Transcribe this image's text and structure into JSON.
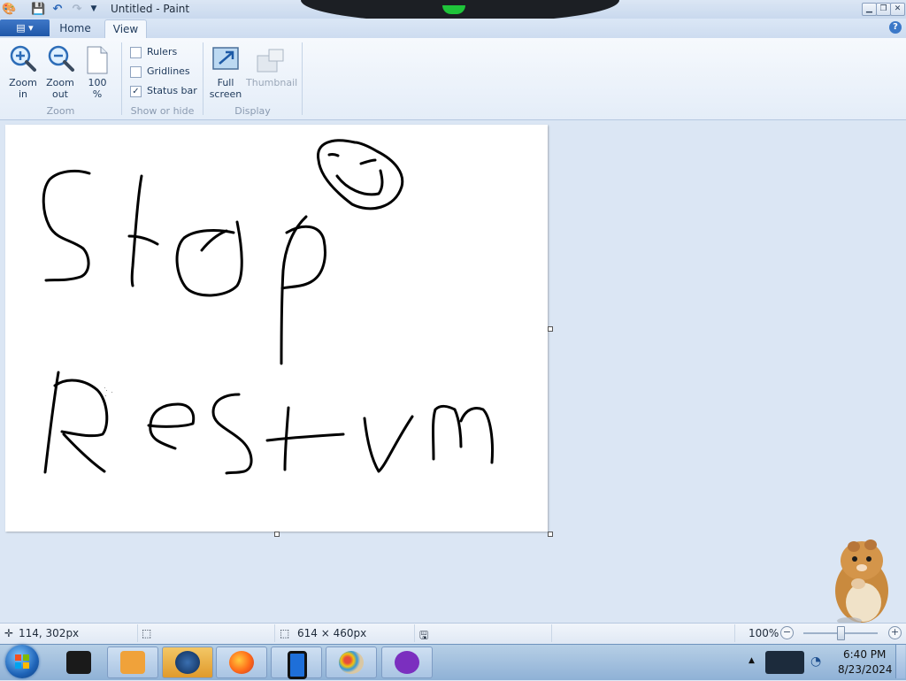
{
  "window": {
    "title": "Untitled - Paint"
  },
  "tabs": {
    "home": "Home",
    "view": "View"
  },
  "ribbon": {
    "zoom_group": {
      "zoom_in_line1": "Zoom",
      "zoom_in_line2": "in",
      "zoom_out_line1": "Zoom",
      "zoom_out_line2": "out",
      "hundred_line1": "100",
      "hundred_line2": "%",
      "label": "Zoom"
    },
    "show_hide": {
      "rulers": "Rulers",
      "rulers_checked": false,
      "gridlines": "Gridlines",
      "gridlines_checked": false,
      "status_bar": "Status bar",
      "status_bar_checked": true,
      "label": "Show or hide"
    },
    "display": {
      "full_screen_line1": "Full",
      "full_screen_line2": "screen",
      "thumbnail": "Thumbnail",
      "label": "Display"
    }
  },
  "status": {
    "cursor_pos": "114, 302px",
    "canvas_size": "614 × 460px",
    "zoom": "100%"
  },
  "taskbar": {
    "apps": [
      {
        "name": "terminal-app"
      },
      {
        "name": "media-player-app"
      },
      {
        "name": "globe-app"
      },
      {
        "name": "firefox-app"
      },
      {
        "name": "phone-app"
      },
      {
        "name": "paint-app"
      },
      {
        "name": "mask-app"
      }
    ],
    "time": "6:40 PM",
    "date": "8/23/2024"
  }
}
